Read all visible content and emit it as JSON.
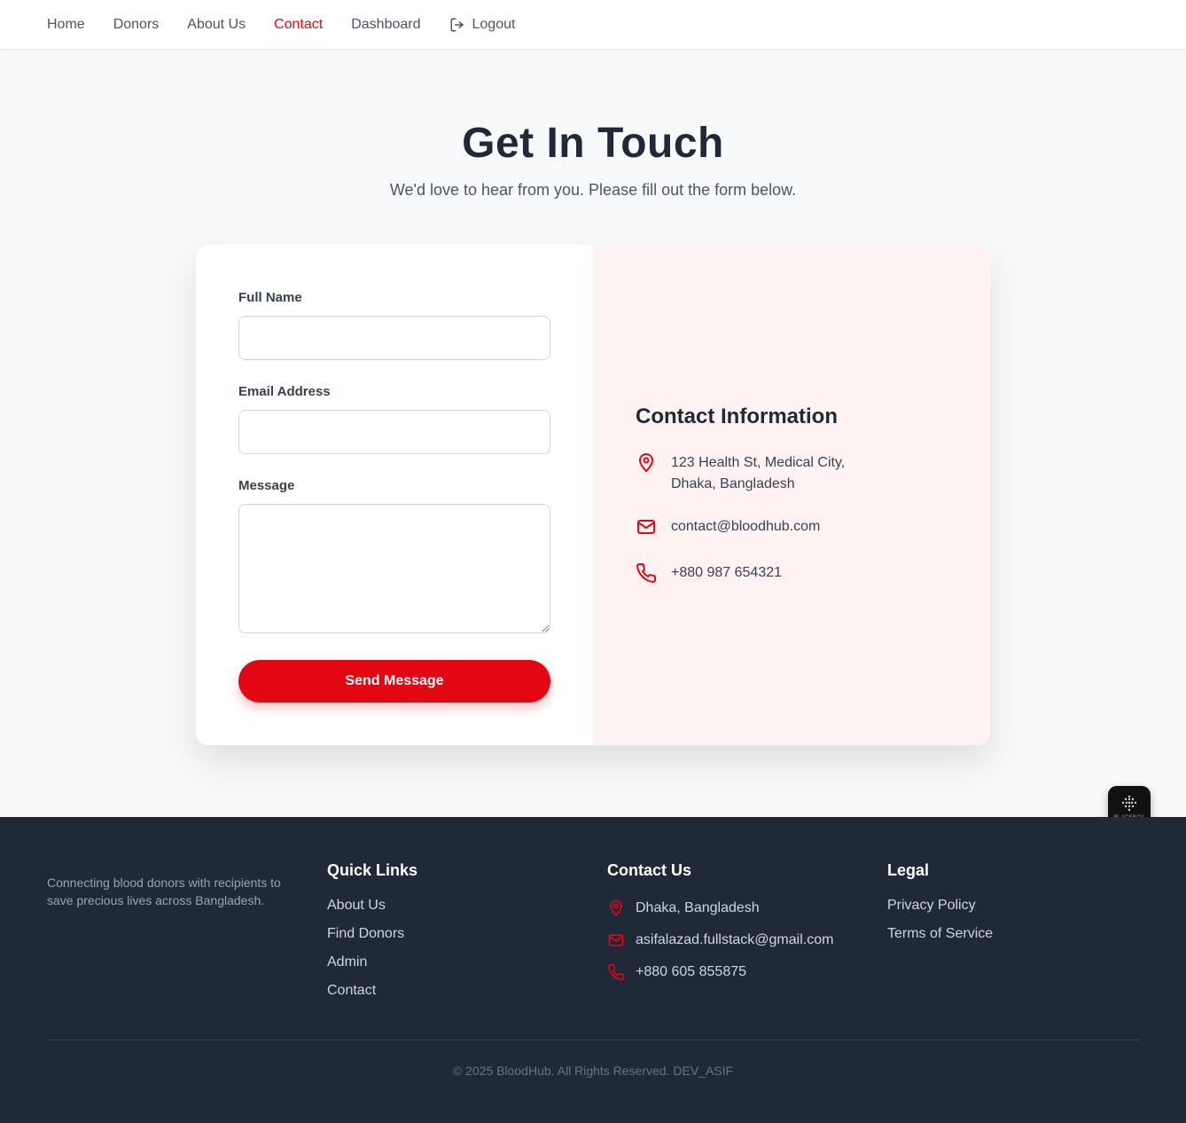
{
  "nav": {
    "items": [
      {
        "label": "Home",
        "active": false
      },
      {
        "label": "Donors",
        "active": false
      },
      {
        "label": "About Us",
        "active": false
      },
      {
        "label": "Contact",
        "active": true
      },
      {
        "label": "Dashboard",
        "active": false
      }
    ],
    "logout_label": "Logout",
    "logout_icon": "logout-icon"
  },
  "hero": {
    "title": "Get In Touch",
    "subtitle": "We'd love to hear from you. Please fill out the form below."
  },
  "form": {
    "name_label": "Full Name",
    "name_value": "",
    "email_label": "Email Address",
    "email_value": "",
    "message_label": "Message",
    "message_value": "",
    "submit_label": "Send Message"
  },
  "contact_info": {
    "title": "Contact Information",
    "address": "123 Health St, Medical City, Dhaka, Bangladesh",
    "email": "contact@bloodhub.com",
    "phone": "+880 987 654321",
    "icons": [
      "map-pin-icon",
      "mail-icon",
      "phone-icon"
    ]
  },
  "badge": {
    "label": "BLACKBOX"
  },
  "footer": {
    "description": "Connecting blood donors with recipients to save precious lives across Bangladesh.",
    "quick_links": {
      "title": "Quick Links",
      "items": [
        "About Us",
        "Find Donors",
        "Admin",
        "Contact"
      ]
    },
    "contact": {
      "title": "Contact Us",
      "location": "Dhaka, Bangladesh",
      "email": "asifalazad.fullstack@gmail.com",
      "phone": "+880 605 855875"
    },
    "legal": {
      "title": "Legal",
      "items": [
        "Privacy Policy",
        "Terms of Service"
      ]
    },
    "copyright": "© 2025 BloodHub. All Rights Reserved. DEV_ASIF"
  },
  "colors": {
    "accent": "#e30613",
    "footer_bg": "#1f2937",
    "info_bg": "#fef2f2",
    "page_bg": "#f8f9fb"
  }
}
